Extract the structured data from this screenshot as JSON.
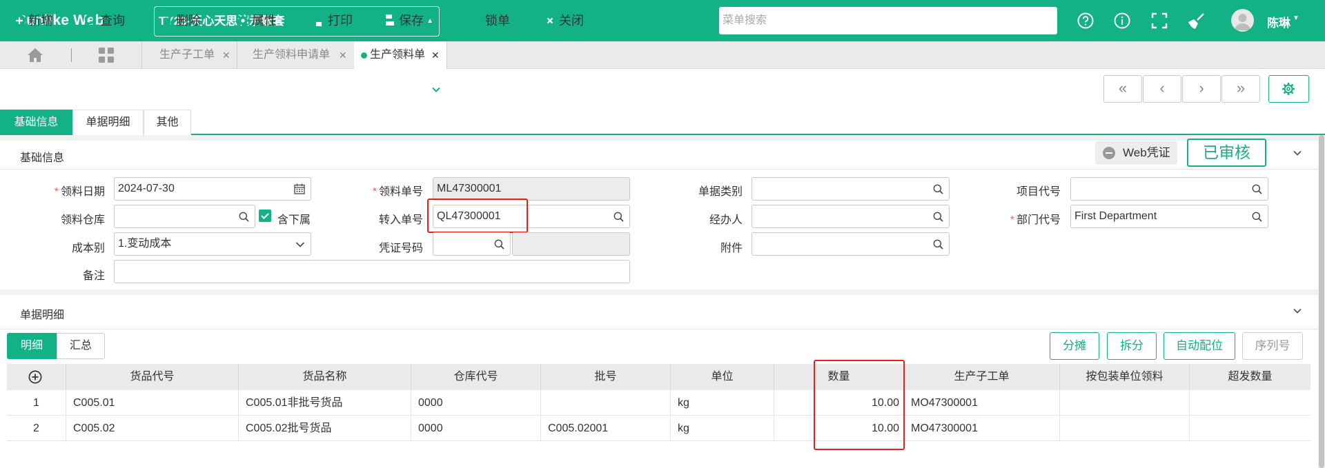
{
  "app": {
    "brand": "Sunlike Web",
    "account": "TY23-天心天思演示账套",
    "search_placeholder": "菜单搜索",
    "user": "陈琳"
  },
  "tabs": [
    {
      "label": "生产子工单"
    },
    {
      "label": "生产领料申请单"
    },
    {
      "label": "生产领料单",
      "active": true
    }
  ],
  "toolbar": {
    "new": "新增",
    "query": "查询",
    "delete": "删除",
    "props": "属性",
    "print": "打印",
    "save": "保存",
    "lock": "锁单",
    "close": "关闭",
    "nav": [
      "«",
      "‹",
      "›",
      "»"
    ]
  },
  "subtabs": [
    "基础信息",
    "单据明细",
    "其他"
  ],
  "basic": {
    "title": "基础信息",
    "web_voucher": "Web凭证",
    "status": "已审核",
    "fields": {
      "issue_date_label": "领料日期",
      "issue_date": "2024-07-30",
      "issue_no_label": "领料单号",
      "issue_no": "ML47300001",
      "doc_type_label": "单据类别",
      "doc_type": "",
      "project_label": "项目代号",
      "project": "",
      "warehouse_label": "领料仓库",
      "warehouse": "",
      "include_sub_label": "含下属",
      "include_sub": true,
      "transfer_no_label": "转入单号",
      "transfer_no": "QL47300001",
      "handler_label": "经办人",
      "handler": "",
      "dept_label": "部门代号",
      "dept": "First Department",
      "cost_label": "成本别",
      "cost": "1.变动成本",
      "voucher_label": "凭证号码",
      "voucher": "",
      "attach_label": "附件",
      "attach": "",
      "remark_label": "备注",
      "remark": ""
    }
  },
  "detail": {
    "title": "单据明细",
    "tabs": [
      "明细",
      "汇总"
    ],
    "actions": [
      "分摊",
      "拆分",
      "自动配位",
      "序列号"
    ],
    "columns": [
      "货品代号",
      "货品名称",
      "仓库代号",
      "批号",
      "单位",
      "数量",
      "生产子工单",
      "按包装单位领料",
      "超发数量"
    ],
    "rows": [
      {
        "no": "1",
        "code": "C005.01",
        "name": "C005.01非批号货品",
        "wh": "0000",
        "batch": "",
        "unit": "kg",
        "qty": "10.00",
        "mo": "MO47300001",
        "pack": "",
        "over": ""
      },
      {
        "no": "2",
        "code": "C005.02",
        "name": "C005.02批号货品",
        "wh": "0000",
        "batch": "C005.02001",
        "unit": "kg",
        "qty": "10.00",
        "mo": "MO47300001",
        "pack": "",
        "over": ""
      }
    ]
  },
  "colors": {
    "accent": "#13b186",
    "highlight": "#e0231a"
  }
}
